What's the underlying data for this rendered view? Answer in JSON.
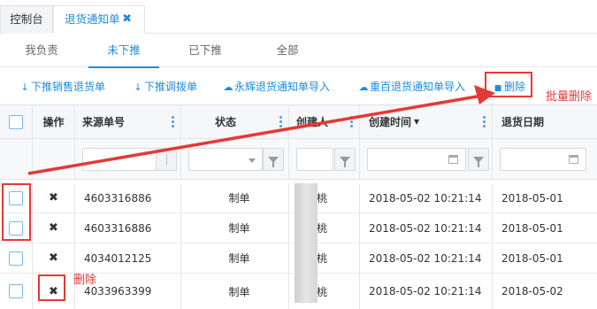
{
  "tabs": {
    "home": "控制台",
    "active": "退货通知单",
    "close_glyph": "✖"
  },
  "subtabs": [
    "我负责",
    "未下推",
    "已下推",
    "全部"
  ],
  "active_subtab_index": 1,
  "toolbar": {
    "push_sales_return": "下推销售退货单",
    "push_transfer": "下推调拨单",
    "import_yonghui": "永辉退货通知单导入",
    "import_chongbai": "重百退货通知单导入",
    "delete": "删除"
  },
  "columns": {
    "action": "操作",
    "source_no": "来源单号",
    "status": "状态",
    "creator": "创建人",
    "created_time": "创建时间",
    "return_date": "退货日期"
  },
  "rows": [
    {
      "source_no": "4603316886",
      "status": "制单",
      "creator_visible": "桃",
      "created_time": "2018-05-02 10:21:14",
      "return_date": "2018-05-01"
    },
    {
      "source_no": "4603316886",
      "status": "制单",
      "creator_visible": "桃",
      "created_time": "2018-05-02 10:21:14",
      "return_date": "2018-05-01"
    },
    {
      "source_no": "4034012125",
      "status": "制单",
      "creator_visible": "桃",
      "created_time": "2018-05-02 10:21:14",
      "return_date": "2018-05-01"
    },
    {
      "source_no": "4033963399",
      "status": "制单",
      "creator_visible": "桃",
      "created_time": "2018-05-02 10:21:14",
      "return_date": "2018-05-02"
    }
  ],
  "annotations": {
    "batch_delete": "批量删除",
    "delete": "删除"
  },
  "colors": {
    "accent": "#1a8de0",
    "annotation": "#e53935"
  }
}
